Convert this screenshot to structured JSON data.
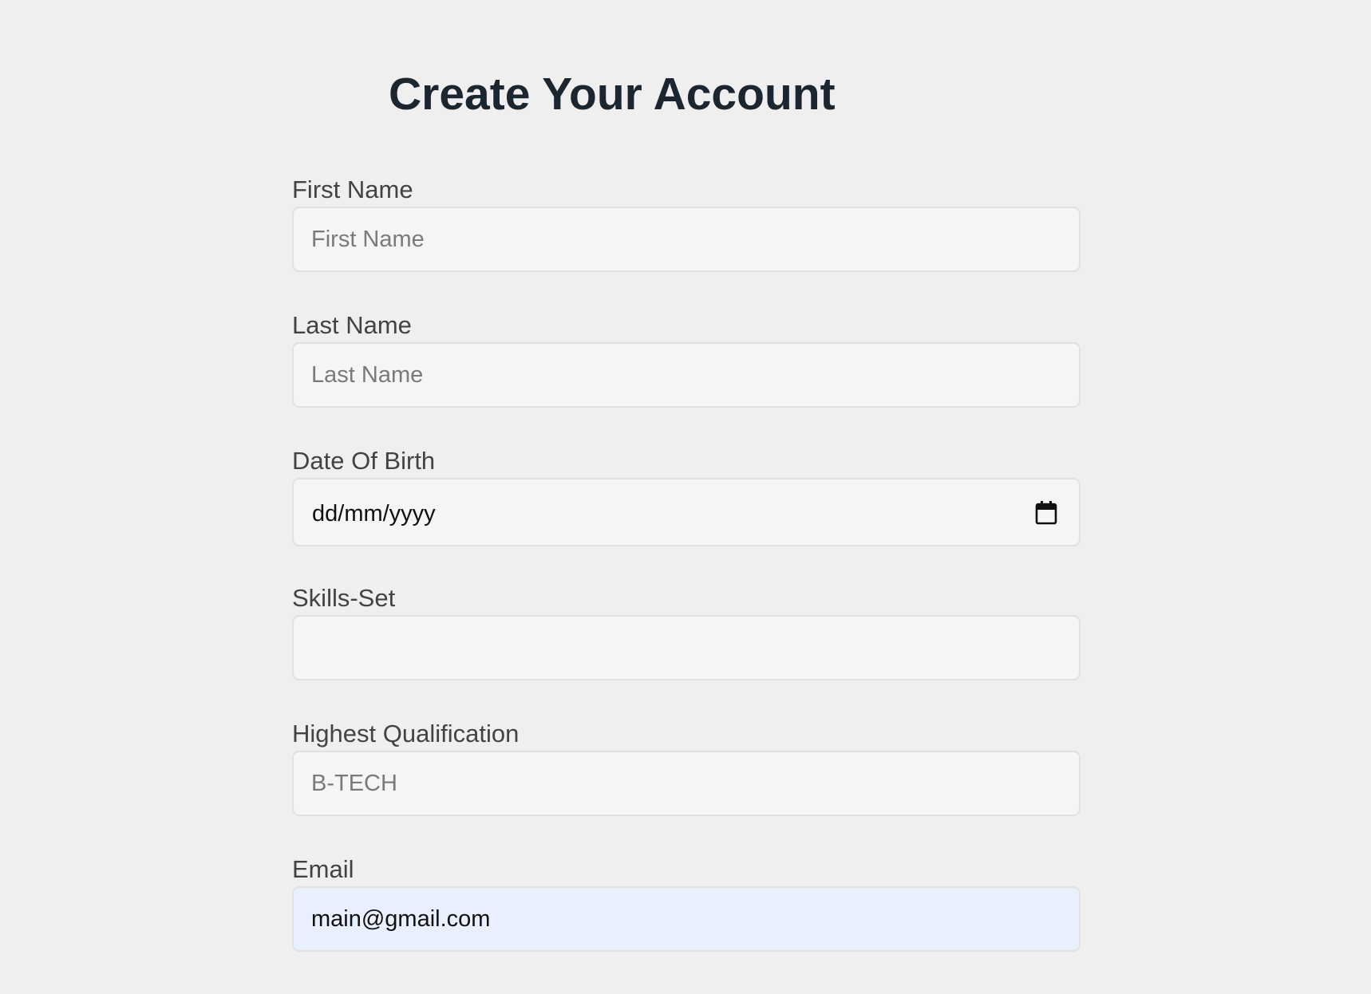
{
  "header": {
    "title": "Create Your Account"
  },
  "fields": {
    "first_name": {
      "label": "First Name",
      "placeholder": "First Name",
      "value": ""
    },
    "last_name": {
      "label": "Last Name",
      "placeholder": "Last Name",
      "value": ""
    },
    "date_of_birth": {
      "label": "Date Of Birth",
      "display": "dd/mm/yyyy",
      "icon": "calendar-icon"
    },
    "skills_set": {
      "label": "Skills-Set",
      "placeholder": "",
      "value": ""
    },
    "highest_qualification": {
      "label": "Highest Qualification",
      "placeholder": "B-TECH",
      "value": ""
    },
    "email": {
      "label": "Email",
      "placeholder": "",
      "value": "main@gmail.com"
    }
  },
  "colors": {
    "background": "#efefef",
    "input_background": "#f5f5f5",
    "autofill_background": "#e8f0fe",
    "title": "#1b2631",
    "label": "#414345"
  }
}
